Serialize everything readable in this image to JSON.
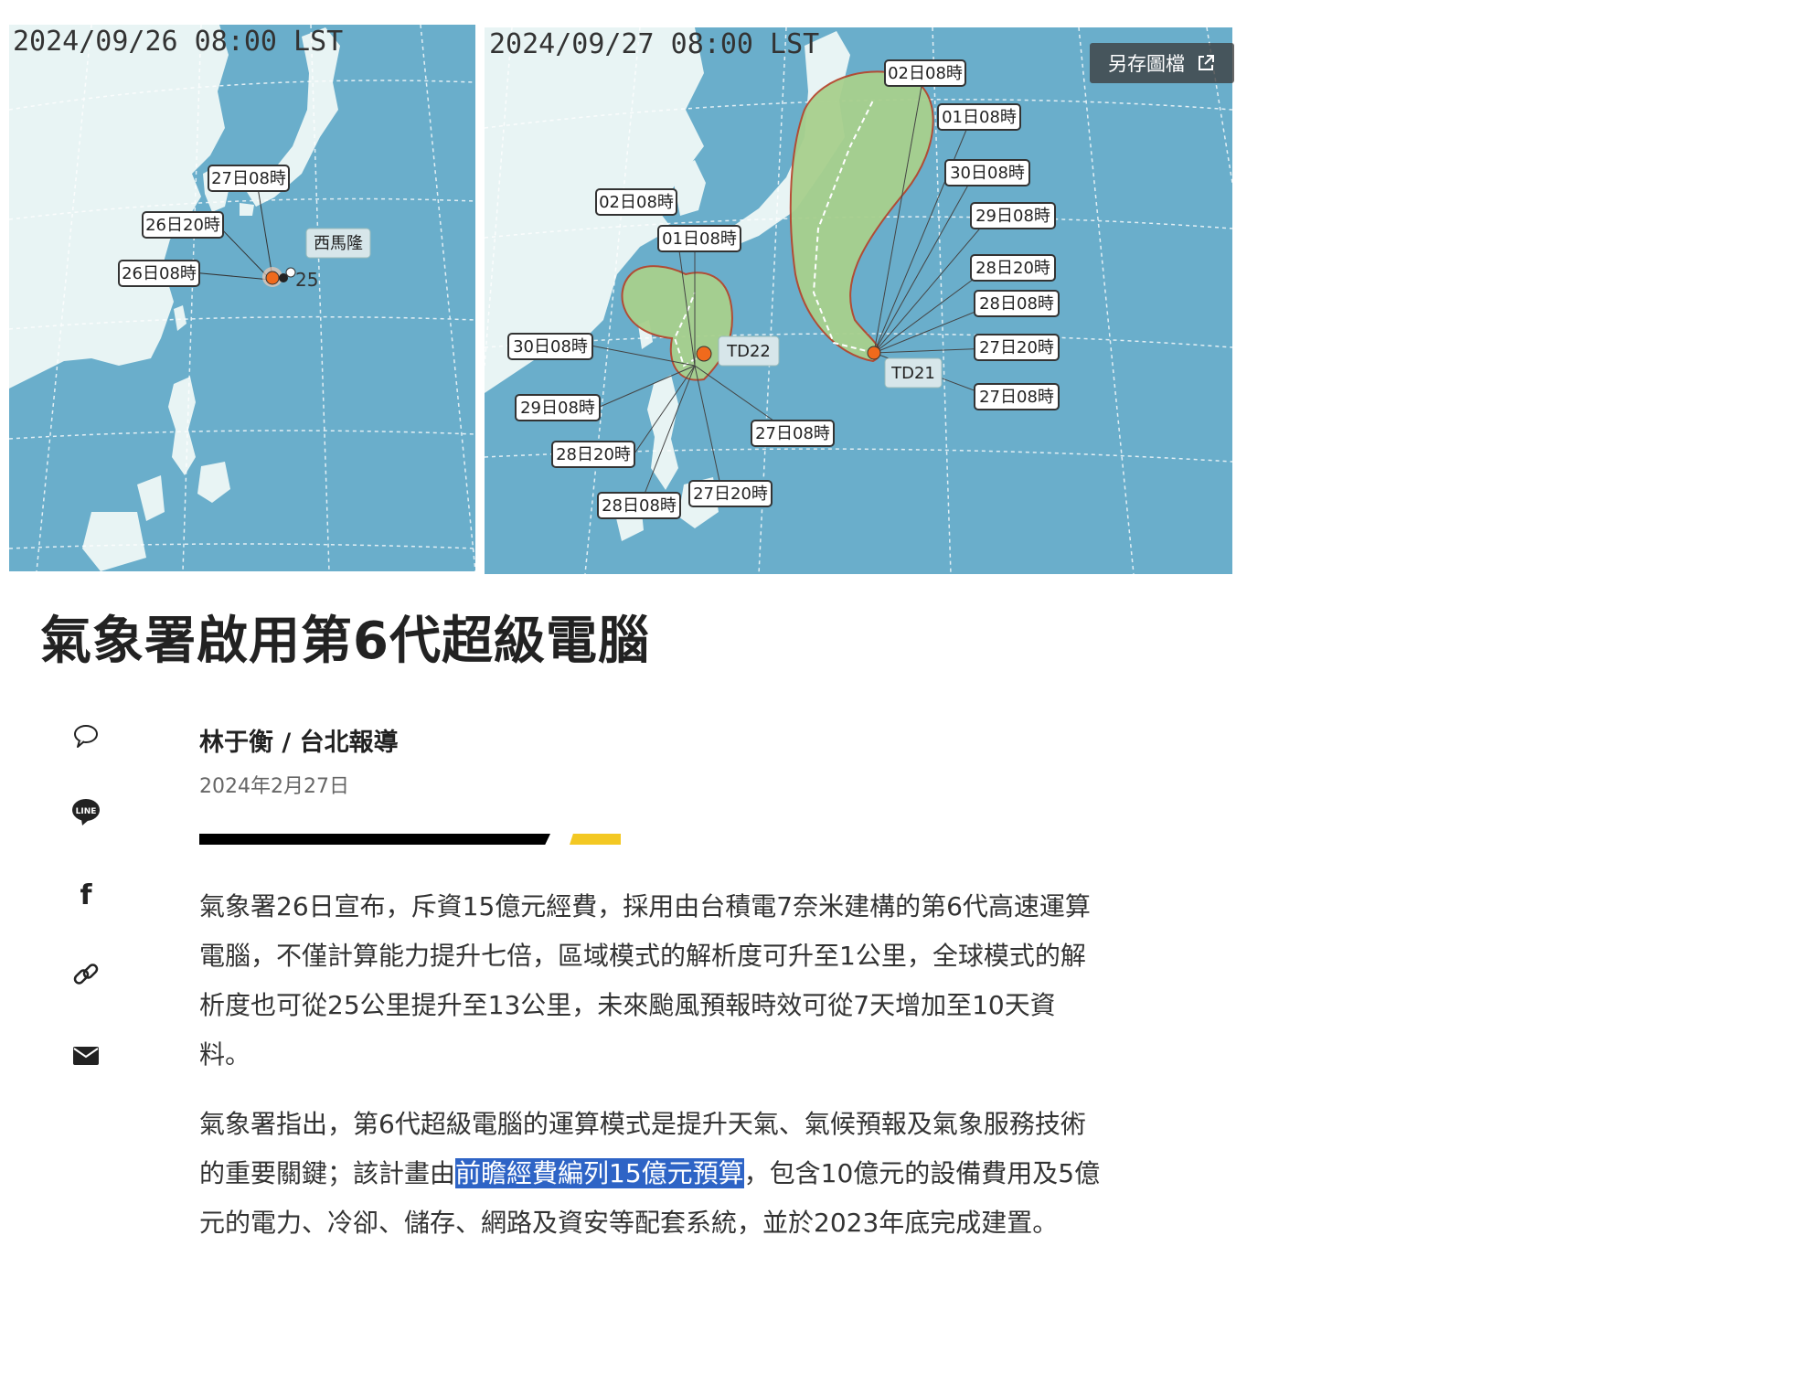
{
  "maps": {
    "left": {
      "timestamp": "2024/09/26 08:00 LST",
      "storm_name": "西馬隆",
      "storm_number": "25",
      "track_labels": [
        "27日08時",
        "26日20時",
        "26日08時"
      ]
    },
    "right": {
      "timestamp": "2024/09/27 08:00 LST",
      "save_label": "另存圖檔",
      "storms": [
        {
          "name": "TD22",
          "track_labels": [
            "02日08時",
            "01日08時",
            "30日08時",
            "29日08時",
            "28日20時",
            "28日08時",
            "27日20時",
            "27日08時"
          ]
        },
        {
          "name": "TD21",
          "track_labels": [
            "02日08時",
            "01日08時",
            "30日08時",
            "29日08時",
            "28日20時",
            "28日08時",
            "27日20時",
            "27日08時"
          ]
        }
      ]
    }
  },
  "article": {
    "title": "氣象署啟用第6代超級電腦",
    "byline": "林于衡 / 台北報導",
    "date": "2024年2月27日",
    "p1": "氣象署26日宣布，斥資15億元經費，採用由台積電7奈米建構的第6代高速運算電腦，不僅計算能力提升七倍，區域模式的解析度可升至1公里，全球模式的解析度也可從25公里提升至13公里，未來颱風預報時效可從7天增加至10天資料。",
    "p2_before": "氣象署指出，第6代超級電腦的運算模式是提升天氣、氣候預報及氣象服務技術的重要關鍵；該計畫由",
    "p2_highlight": "前瞻經費編列15億元預算",
    "p2_after": "，包含10億元的設備費用及5億元的電力、冷卻、儲存、網路及資安等配套系統，並於2023年底完成建置。"
  },
  "share": {
    "icons": [
      "comment-icon",
      "line-icon",
      "facebook-icon",
      "link-icon",
      "mail-icon"
    ],
    "line_text": "LINE",
    "facebook_text": "f"
  },
  "colors": {
    "ocean": "#6aaecb",
    "land": "#e8f4f4",
    "cone_fill": "#a8d08d",
    "cone_stroke": "#b5472e",
    "storm_dot": "#f06a1c",
    "highlight": "#2e64c6",
    "rule_black": "#000000",
    "rule_yellow": "#f3c823"
  }
}
